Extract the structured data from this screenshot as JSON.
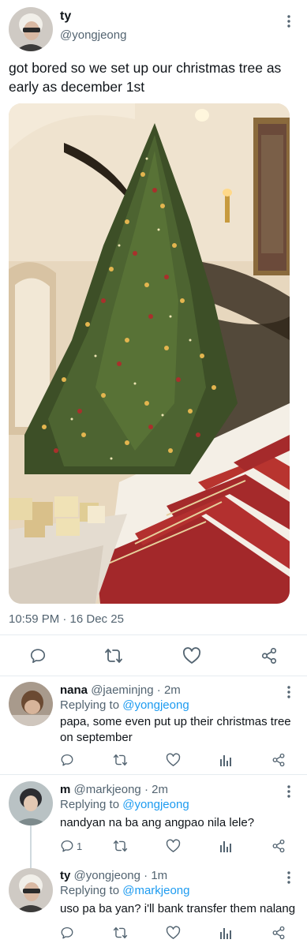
{
  "tweet": {
    "name": "ty",
    "handle": "@yongjeong",
    "text": "got bored so we set up our christmas tree as early as december 1st",
    "timestamp": "10:59 PM · 16 Dec 25",
    "media_description": "christmas-tree-staircase-photo"
  },
  "replies": [
    {
      "name": "nana",
      "handle": "@jaeminjng",
      "time": "· 2m",
      "replying_prefix": "Replying to",
      "replying_to": "@yongjeong",
      "text": "papa, some even put up their christmas tree on september",
      "reply_count": ""
    },
    {
      "name": "m",
      "handle": "@markjeong",
      "time": "· 2m",
      "replying_prefix": "Replying to",
      "replying_to": "@yongjeong",
      "text": "nandyan na ba ang angpao nila lele?",
      "reply_count": "1"
    },
    {
      "name": "ty",
      "handle": "@yongjeong",
      "time": "· 1m",
      "replying_prefix": "Replying to",
      "replying_to": "@markjeong",
      "text": "uso pa ba yan? i'll bank transfer them nalang",
      "reply_count": ""
    }
  ],
  "colors": {
    "text": "#0f1419",
    "secondary": "#536471",
    "link": "#1d9bf0",
    "divider": "#e6ecf0"
  },
  "icons": [
    "more-icon",
    "reply-icon",
    "retweet-icon",
    "like-icon",
    "share-icon",
    "analytics-icon"
  ]
}
